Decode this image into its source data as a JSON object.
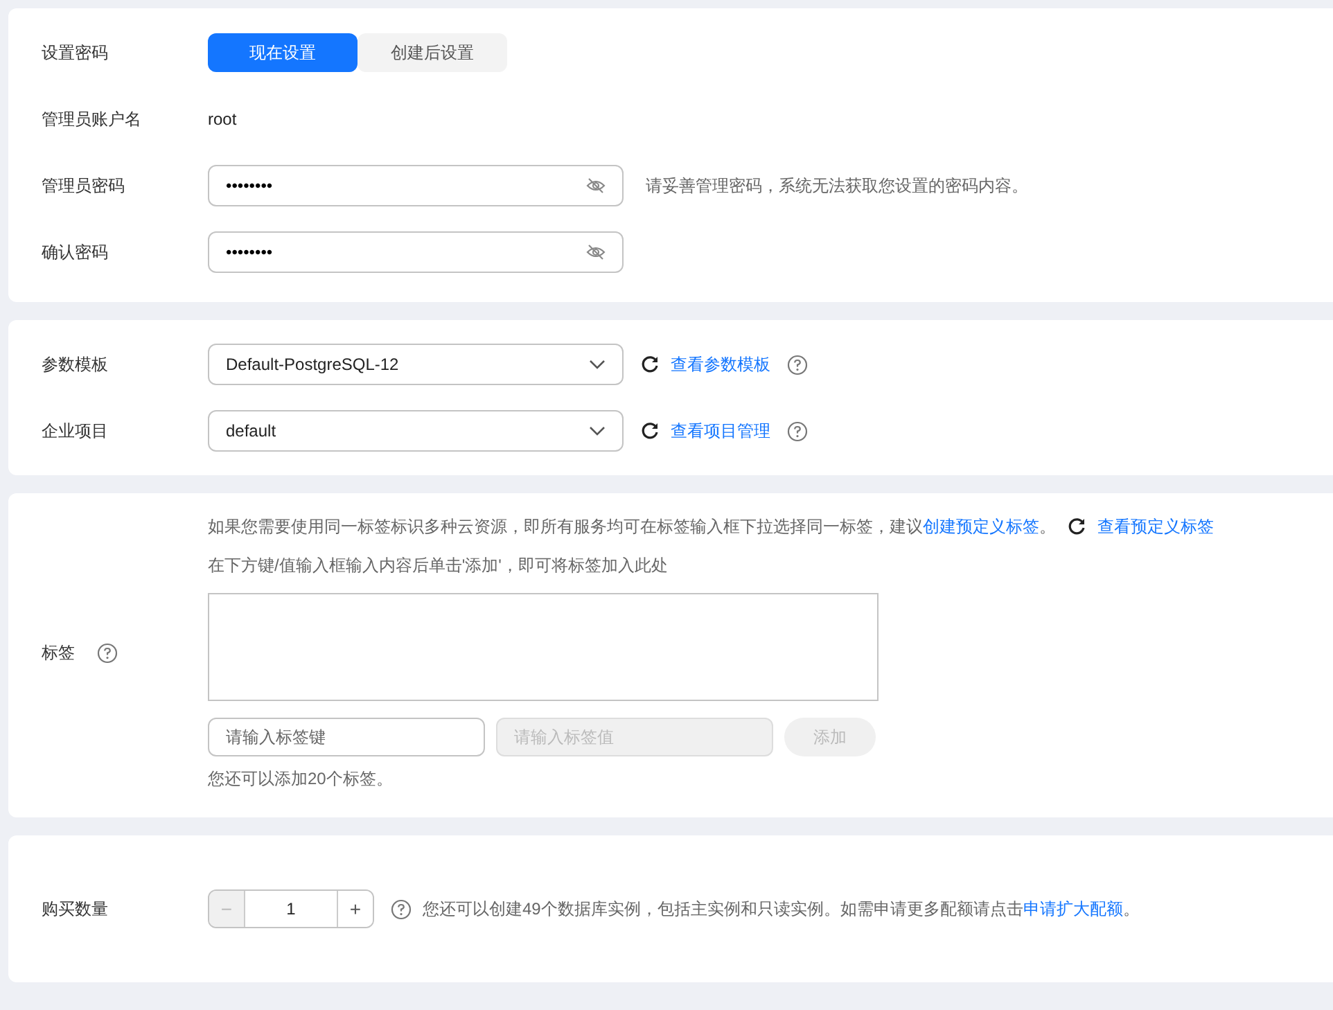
{
  "password_section": {
    "label": "设置密码",
    "options": [
      {
        "label": "现在设置",
        "selected": true
      },
      {
        "label": "创建后设置",
        "selected": false
      }
    ],
    "admin_account": {
      "label": "管理员账户名",
      "value": "root"
    },
    "admin_password": {
      "label": "管理员密码",
      "value": "••••••••",
      "hint": "请妥善管理密码，系统无法获取您设置的密码内容。"
    },
    "confirm_password": {
      "label": "确认密码",
      "value": "••••••••"
    }
  },
  "config_section": {
    "rows": [
      {
        "label": "参数模板",
        "value": "Default-PostgreSQL-12",
        "link": "查看参数模板"
      },
      {
        "label": "企业项目",
        "value": "default",
        "link": "查看项目管理"
      }
    ]
  },
  "tags_section": {
    "label": "标签",
    "hint": "如果您需要使用同一标签标识多种云资源，即所有服务均可在标签输入框下拉选择同一标签，建议",
    "hint_link": "创建预定义标签",
    "hint_end": "。",
    "view_link": "查看预定义标签",
    "instruction": "在下方键/值输入框输入内容后单击'添加'，即可将标签加入此处",
    "key_field": {
      "placeholder": "请输入标签键",
      "disabled": false
    },
    "value_field": {
      "placeholder": "请输入标签值",
      "disabled": true
    },
    "add_button": {
      "label": "添加",
      "disabled": true
    },
    "remaining": "您还可以添加20个标签。"
  },
  "quantity_section": {
    "label": "购买数量",
    "minus": {
      "label": "−",
      "disabled": true
    },
    "value": "1",
    "plus": {
      "label": "+",
      "disabled": false
    },
    "note": "您还可以创建49个数据库实例，包括主实例和只读实例。如需申请更多配额请点击",
    "note_link": "申请扩大配额",
    "note_end": "。"
  }
}
